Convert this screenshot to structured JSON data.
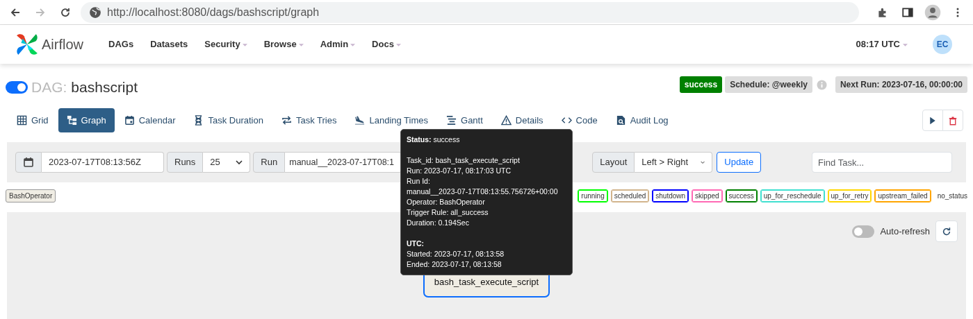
{
  "browser": {
    "url": "http://localhost:8080/dags/bashscript/graph",
    "forward_disabled": true
  },
  "navbar": {
    "brand": "Airflow",
    "items": [
      {
        "label": "DAGs",
        "dropdown": false
      },
      {
        "label": "Datasets",
        "dropdown": false
      },
      {
        "label": "Security",
        "dropdown": true
      },
      {
        "label": "Browse",
        "dropdown": true
      },
      {
        "label": "Admin",
        "dropdown": true
      },
      {
        "label": "Docs",
        "dropdown": true
      }
    ],
    "clock": "08:17 UTC",
    "user_initials": "EC"
  },
  "dag": {
    "paused_toggle_on": true,
    "label": "DAG:",
    "name": "bashscript",
    "badges": [
      {
        "kind": "state",
        "text": "success",
        "color": "#008000"
      },
      {
        "kind": "schedule",
        "text": "Schedule: @weekly"
      },
      {
        "kind": "info"
      },
      {
        "kind": "next",
        "text": "Next Run: 2023-07-16, 00:00:00"
      }
    ]
  },
  "tabs": [
    {
      "kind": "grid",
      "label": "Grid",
      "selected": false
    },
    {
      "kind": "graph",
      "label": "Graph",
      "selected": true
    },
    {
      "kind": "calendar",
      "label": "Calendar",
      "selected": false
    },
    {
      "kind": "duration",
      "label": "Task Duration",
      "selected": false
    },
    {
      "kind": "tries",
      "label": "Task Tries",
      "selected": false
    },
    {
      "kind": "landing",
      "label": "Landing Times",
      "selected": false
    },
    {
      "kind": "gantt",
      "label": "Gantt",
      "selected": false
    },
    {
      "kind": "details",
      "label": "Details",
      "selected": false
    },
    {
      "kind": "code",
      "label": "Code",
      "selected": false
    },
    {
      "kind": "audit",
      "label": "Audit Log",
      "selected": false
    }
  ],
  "filters": {
    "base_date": "2023-07-17T08:13:56Z",
    "runs_label": "Runs",
    "runs_value": "25",
    "run_label": "Run",
    "run_value": "manual__2023-07-17T08:1",
    "layout_label": "Layout",
    "layout_value": "Left > Right",
    "update_button": "Update",
    "find_placeholder": "Find Task..."
  },
  "legend": {
    "operators": [
      {
        "label": "BashOperator",
        "color": "#f0ede4"
      }
    ],
    "states": [
      {
        "label": "running",
        "color": "#00ff00"
      },
      {
        "label": "scheduled",
        "color": "#d2b48c"
      },
      {
        "label": "shutdown",
        "color": "#0000ff"
      },
      {
        "label": "skipped",
        "color": "#ff69b4"
      },
      {
        "label": "success",
        "color": "#008000"
      },
      {
        "label": "up_for_reschedule",
        "color": "#40e0d0"
      },
      {
        "label": "up_for_retry",
        "color": "#ffd700"
      },
      {
        "label": "upstream_failed",
        "color": "#ffa500"
      },
      {
        "label": "no_status"
      }
    ]
  },
  "graph": {
    "auto_refresh": {
      "label": "Auto-refresh",
      "on": false
    },
    "node": {
      "label": "bash_task_execute_script",
      "color": "#f0ede4"
    },
    "tooltip": {
      "sections": [
        [
          "**Status:** success"
        ],
        [
          "Task_id: bash_task_execute_script",
          "Run: 2023-07-17, 08:17:03 UTC",
          "Run Id:",
          "manual__2023-07-17T08:13:55.756726+00:00",
          "Operator: BashOperator",
          "Trigger Rule: all_success",
          "Duration: 0.194Sec"
        ],
        [
          "**UTC:**",
          "Started: 2023-07-17, 08:13:58",
          "Ended: 2023-07-17, 08:13:58"
        ]
      ]
    }
  }
}
